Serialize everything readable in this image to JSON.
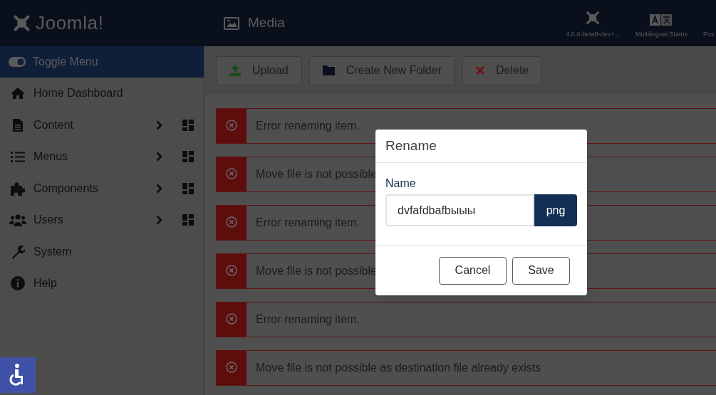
{
  "header": {
    "logo": "Joomla!",
    "page_title": "Media",
    "status_items": [
      {
        "kind": "version",
        "label": "4.0.0-beta8-dev+..."
      },
      {
        "kind": "language",
        "label": "Multilingual Status"
      },
      {
        "kind": "cut",
        "label": "Pos"
      }
    ]
  },
  "sidebar": {
    "toggle": {
      "label": "Toggle Menu",
      "on": true
    },
    "items": [
      {
        "label": "Home Dashboard",
        "expandable": false
      },
      {
        "label": "Content",
        "expandable": true
      },
      {
        "label": "Menus",
        "expandable": true
      },
      {
        "label": "Components",
        "expandable": true
      },
      {
        "label": "Users",
        "expandable": true
      },
      {
        "label": "System",
        "expandable": false
      },
      {
        "label": "Help",
        "expandable": false
      }
    ]
  },
  "toolbar": [
    {
      "label": "Upload"
    },
    {
      "label": "Create New Folder"
    },
    {
      "label": "Delete"
    }
  ],
  "alerts": [
    {
      "message": "Error renaming item."
    },
    {
      "message": "Move file is not possible"
    },
    {
      "message": "Error renaming item."
    },
    {
      "message": "Move file is not possible"
    },
    {
      "message": "Error renaming item."
    },
    {
      "message": "Move file is not possible as destination file already exists"
    }
  ],
  "dialog": {
    "title": "Rename",
    "field_label": "Name",
    "value": "dvfafdbafbыыы",
    "extension": "png",
    "buttons": [
      "Cancel",
      "Save"
    ]
  }
}
